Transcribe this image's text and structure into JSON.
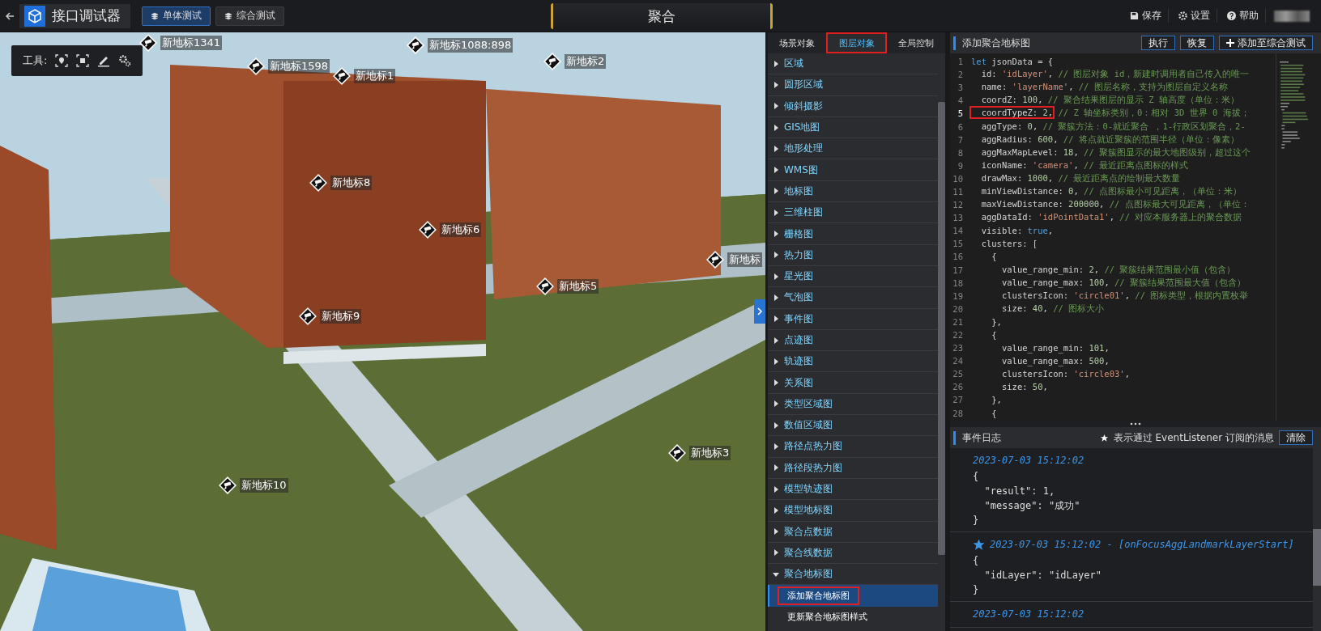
{
  "app": {
    "title": "接口调试器",
    "tabs": [
      {
        "label": "单体测试",
        "selected": true
      },
      {
        "label": "综合测试",
        "selected": false
      }
    ],
    "center_title": "聚合",
    "actions": [
      {
        "label": "保存",
        "kind": "save"
      },
      {
        "label": "设置",
        "kind": "settings"
      },
      {
        "label": "帮助",
        "kind": "help"
      }
    ]
  },
  "map": {
    "kind": "picture",
    "toolbar": {
      "label": "工具:"
    },
    "markers": [
      {
        "label": "新地标1341"
      },
      {
        "label": "新地标1598"
      },
      {
        "label": "新地标1088:898"
      },
      {
        "label": "新地标2"
      },
      {
        "label": "新地标1"
      },
      {
        "label": "新地标8"
      },
      {
        "label": "新地标6"
      },
      {
        "label": "新地标"
      },
      {
        "label": "新地标5"
      },
      {
        "label": "新地标9"
      },
      {
        "label": "新地标3"
      },
      {
        "label": "新地标10"
      }
    ]
  },
  "sidebar": {
    "tabs": [
      {
        "label": "场景对象",
        "selected": false,
        "highlight": false
      },
      {
        "label": "图层对象",
        "selected": true,
        "highlight": true
      },
      {
        "label": "全局控制",
        "selected": false,
        "highlight": false
      }
    ],
    "items": [
      {
        "label": "区域",
        "expanded": false
      },
      {
        "label": "圆形区域",
        "expanded": false
      },
      {
        "label": "倾斜摄影",
        "expanded": false
      },
      {
        "label": "GIS地图",
        "expanded": false
      },
      {
        "label": "地形处理",
        "expanded": false
      },
      {
        "label": "WMS图",
        "expanded": false
      },
      {
        "label": "地标图",
        "expanded": false
      },
      {
        "label": "三维柱图",
        "expanded": false
      },
      {
        "label": "栅格图",
        "expanded": false
      },
      {
        "label": "热力图",
        "expanded": false
      },
      {
        "label": "星光图",
        "expanded": false
      },
      {
        "label": "气泡图",
        "expanded": false
      },
      {
        "label": "事件图",
        "expanded": false
      },
      {
        "label": "点迹图",
        "expanded": false
      },
      {
        "label": "轨迹图",
        "expanded": false
      },
      {
        "label": "关系图",
        "expanded": false
      },
      {
        "label": "类型区域图",
        "expanded": false
      },
      {
        "label": "数值区域图",
        "expanded": false
      },
      {
        "label": "路径点热力图",
        "expanded": false
      },
      {
        "label": "路径段热力图",
        "expanded": false
      },
      {
        "label": "模型轨迹图",
        "expanded": false
      },
      {
        "label": "模型地标图",
        "expanded": false
      },
      {
        "label": "聚合点数据",
        "expanded": false
      },
      {
        "label": "聚合线数据",
        "expanded": false
      },
      {
        "label": "聚合地标图",
        "expanded": true,
        "children": [
          {
            "label": "添加聚合地标图",
            "selected": true,
            "highlight": true
          },
          {
            "label": "更新聚合地标图样式",
            "selected": false,
            "highlight": false
          }
        ]
      }
    ]
  },
  "editor": {
    "title": "添加聚合地标图",
    "buttons": [
      {
        "label": "执行",
        "kind": "plain"
      },
      {
        "label": "恢复",
        "kind": "plain"
      },
      {
        "label": "添加至综合测试",
        "kind": "add"
      }
    ],
    "lines": [
      {
        "number": "1",
        "code": "let jsonData = {",
        "highlight": false
      },
      {
        "number": "2",
        "code": "  id: 'idLayer', ",
        "comment": "// 图层对象 id，新建时调用者自己传入的唯一",
        "highlight": false
      },
      {
        "number": "3",
        "code": "  name: 'layerName', ",
        "comment": "// 图层名称，支持为图层自定义名称",
        "highlight": false
      },
      {
        "number": "4",
        "code": "  coordZ: 100, ",
        "comment": "// 聚合结果图层的显示 Z 轴高度（单位：米）",
        "highlight": false
      },
      {
        "number": "5",
        "code": "  coordTypeZ: 2,",
        "comment": " // Z 轴坐标类别，0：相对 3D 世界 0 海拔；",
        "highlight": true
      },
      {
        "number": "6",
        "code": "  aggType: 0, ",
        "comment": "// 聚簇方法：0-就近聚合 ，1-行政区划聚合，2-",
        "highlight": false
      },
      {
        "number": "7",
        "code": "  aggRadius: 600, ",
        "comment": "// 将点就近聚簇的范围半径（单位：像素）",
        "highlight": false
      },
      {
        "number": "8",
        "code": "  aggMaxMapLevel: 18, ",
        "comment": "// 聚簇图显示的最大地图级别，超过这个",
        "highlight": false
      },
      {
        "number": "9",
        "code": "  iconName: 'camera', ",
        "comment": "// 最近距离点图标的样式",
        "highlight": false
      },
      {
        "number": "10",
        "code": "  drawMax: 1000, ",
        "comment": "// 最近距离点的绘制最大数量",
        "highlight": false
      },
      {
        "number": "11",
        "code": "  minViewDistance: 0, ",
        "comment": "// 点图标最小可见距离，（单位：米）",
        "highlight": false
      },
      {
        "number": "12",
        "code": "  maxViewDistance: 200000, ",
        "comment": "// 点图标最大可见距离，（单位：",
        "highlight": false
      },
      {
        "number": "13",
        "code": "  aggDataId: 'idPointData1', ",
        "comment": "// 对应本服务器上的聚合数据",
        "highlight": false
      },
      {
        "number": "14",
        "code": "  visible: true,",
        "highlight": false
      },
      {
        "number": "15",
        "code": "  clusters: [",
        "highlight": false
      },
      {
        "number": "16",
        "code": "    {",
        "highlight": false
      },
      {
        "number": "17",
        "code": "      value_range_min: 2, ",
        "comment": "// 聚簇结果范围最小值（包含）",
        "highlight": false
      },
      {
        "number": "18",
        "code": "      value_range_max: 100, ",
        "comment": "// 聚簇结果范围最大值（包含）",
        "highlight": false
      },
      {
        "number": "19",
        "code": "      clustersIcon: 'circle01', ",
        "comment": "// 图标类型，根据内置枚举",
        "highlight": false
      },
      {
        "number": "20",
        "code": "      size: 40, ",
        "comment": "// 图标大小",
        "highlight": false
      },
      {
        "number": "21",
        "code": "    },",
        "highlight": false
      },
      {
        "number": "22",
        "code": "    {",
        "highlight": false
      },
      {
        "number": "23",
        "code": "      value_range_min: 101,",
        "highlight": false
      },
      {
        "number": "24",
        "code": "      value_range_max: 500,",
        "highlight": false
      },
      {
        "number": "25",
        "code": "      clustersIcon: 'circle03',",
        "highlight": false
      },
      {
        "number": "26",
        "code": "      size: 50,",
        "highlight": false
      },
      {
        "number": "27",
        "code": "    },",
        "highlight": false
      },
      {
        "number": "28",
        "code": "    {",
        "highlight": false
      }
    ]
  },
  "event_log": {
    "title": "事件日志",
    "legend": "表示通过 EventListener 订阅的消息",
    "clear_button": "清除",
    "entries": [
      {
        "starred": false,
        "header": "2023-07-03 15:12:02",
        "body": [
          "{",
          "  \"result\": 1,",
          "  \"message\": \"成功\"",
          "}"
        ]
      },
      {
        "starred": true,
        "header": "2023-07-03 15:12:02 - [onFocusAggLandmarkLayerStart]",
        "body": [
          "{",
          "  \"idLayer\": \"idLayer\"",
          "}"
        ]
      },
      {
        "starred": false,
        "header": "2023-07-03 15:12:02"
      }
    ]
  }
}
